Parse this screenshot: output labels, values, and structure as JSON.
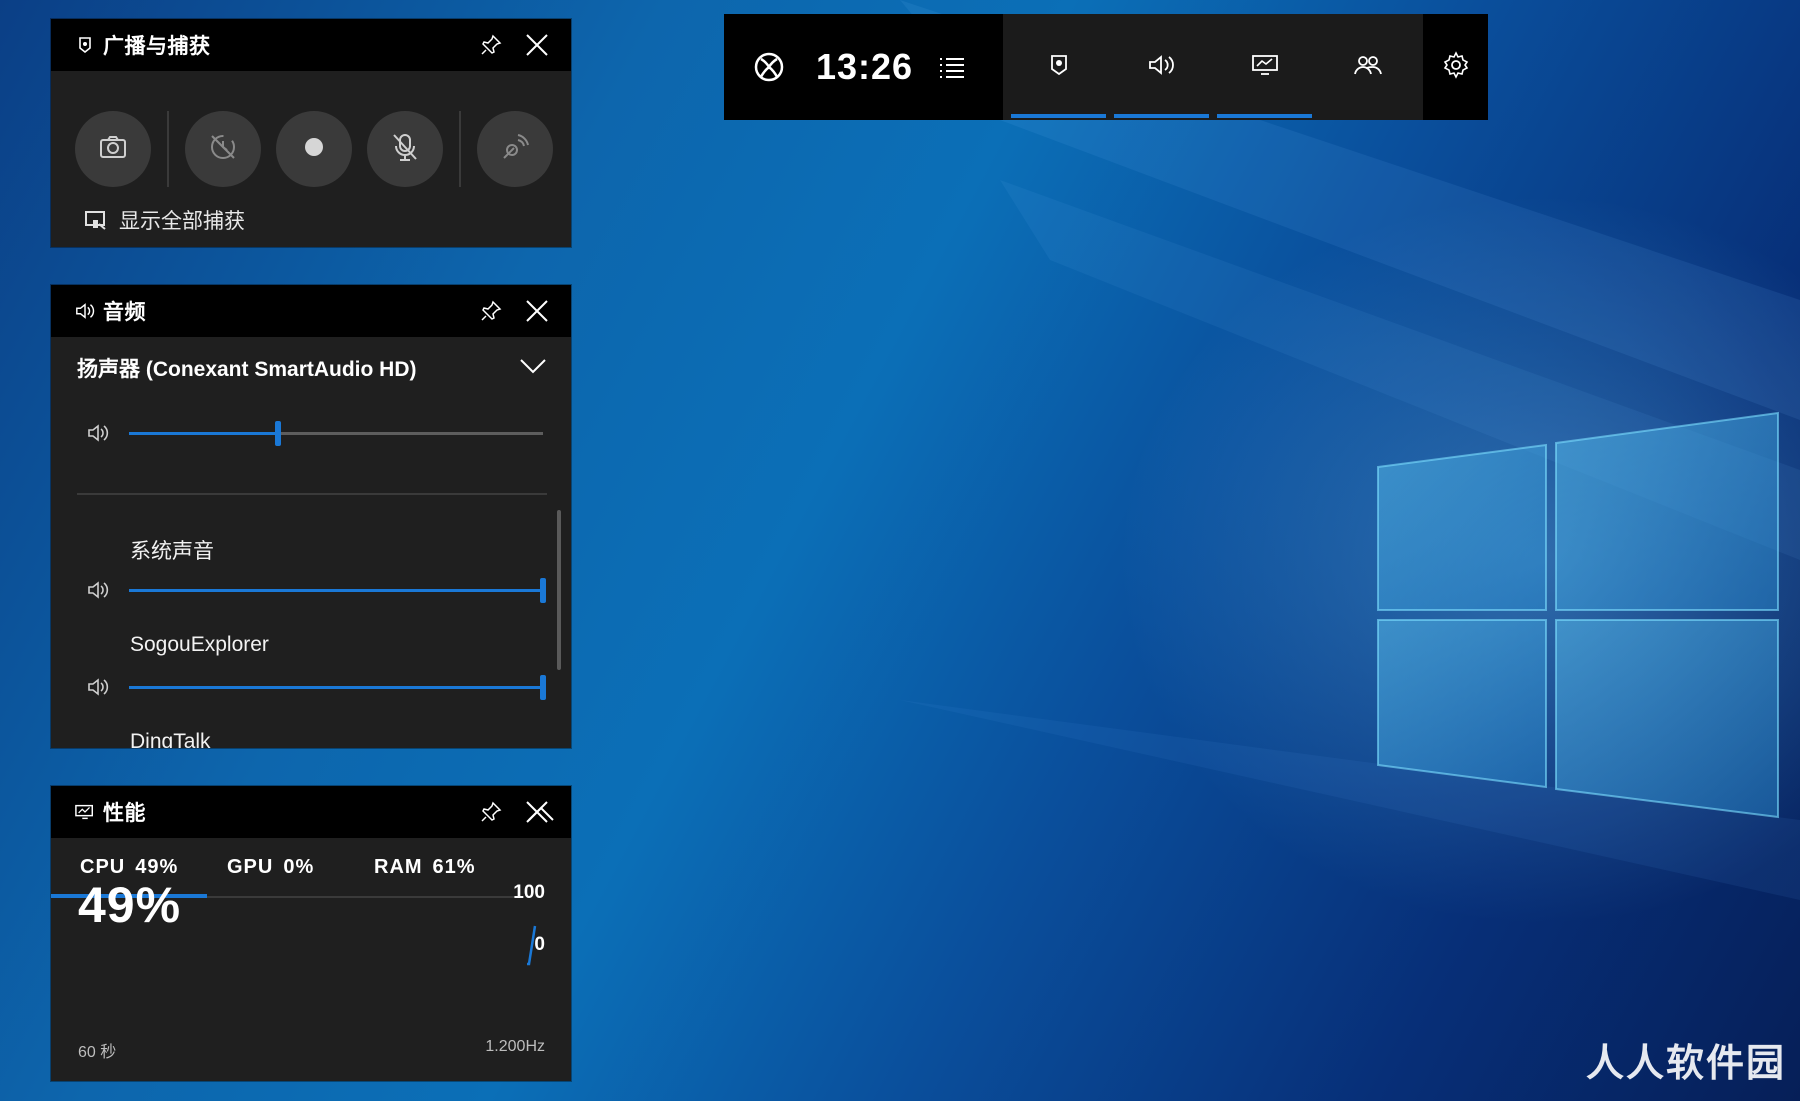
{
  "capture": {
    "title": "广播与捕获",
    "show_all_label": "显示全部捕获"
  },
  "audio": {
    "title": "音频",
    "device": "扬声器 (Conexant SmartAudio HD)",
    "master_volume": 0.36,
    "apps": [
      {
        "name": "系统声音",
        "volume": 1.0
      },
      {
        "name": "SogouExplorer",
        "volume": 1.0
      },
      {
        "name": "DingTalk",
        "volume": null
      }
    ]
  },
  "performance": {
    "title": "性能",
    "tabs": [
      {
        "name": "CPU",
        "value": "49%"
      },
      {
        "name": "GPU",
        "value": "0%"
      },
      {
        "name": "RAM",
        "value": "61%"
      }
    ],
    "big_value": "49%",
    "axis_max": "100",
    "axis_min": "0",
    "footer_left": "60 秒",
    "footer_right": "1.200Hz"
  },
  "topbar": {
    "time": "13:26"
  },
  "watermark": "人人软件园",
  "colors": {
    "accent": "#1a78d6",
    "panel_bg": "#1f1f1f",
    "header_bg": "#000000"
  },
  "icons": [
    "xbox-icon",
    "menu-icon",
    "capture-widget-icon",
    "audio-widget-icon",
    "performance-widget-icon",
    "social-widget-icon",
    "settings-icon",
    "pin-icon",
    "close-icon",
    "camera-icon",
    "record-last-icon",
    "record-icon",
    "mic-off-icon",
    "broadcast-icon",
    "chevron-down-icon",
    "chevron-up-icon",
    "speaker-icon"
  ]
}
